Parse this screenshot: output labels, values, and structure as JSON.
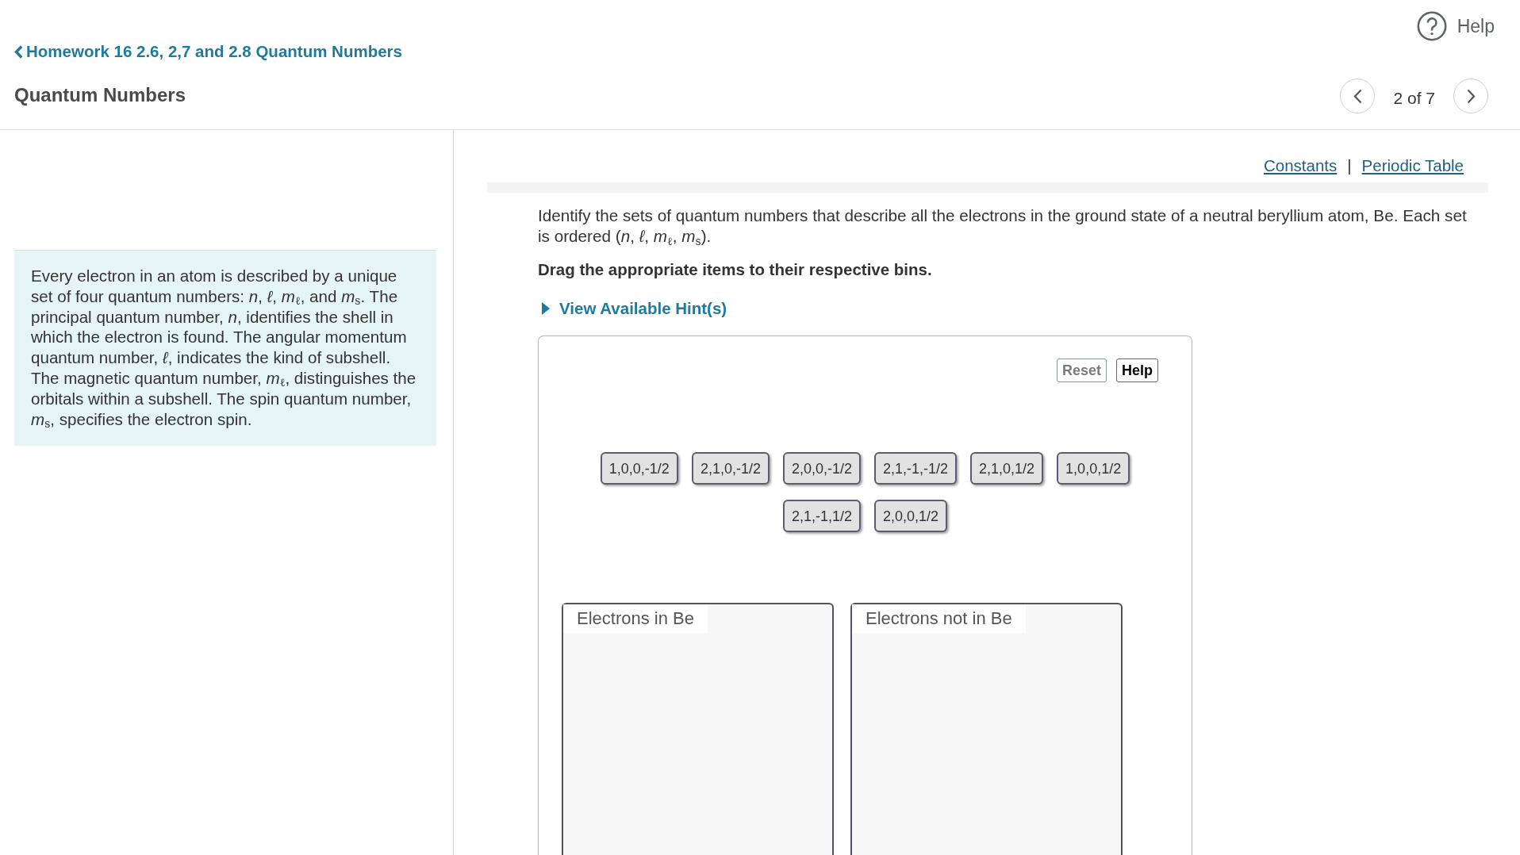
{
  "header": {
    "back_link": "Homework 16 2.6, 2,7 and 2.8 Quantum Numbers",
    "title": "Quantum Numbers",
    "help": "Help",
    "pager": "2 of 7"
  },
  "intro": {
    "text": "Every electron in an atom is described by a unique set of four quantum numbers: *n*, *ℓ*, *m*$_{ℓ}$, and *m*$_{s}$. The principal quantum number, *n*, identifies the shell in which the electron is found. The angular momentum quantum number, *ℓ*, indicates the kind of subshell. The magnetic quantum number, *m*$_{ℓ}$, distinguishes the orbitals within a subshell. The spin quantum number, *m*$_{s}$, specifies the electron spin."
  },
  "resources": {
    "links": [
      "Constants",
      "Periodic Table"
    ],
    "separator": "|"
  },
  "problem": {
    "prompt": "Identify the sets of quantum numbers that describe all the electrons in the ground state of a neutral beryllium atom, Be. Each set is ordered (*n*, *ℓ*, *m*$_{ℓ}$, *m*$_{s}$).",
    "instruction": "Drag the appropriate items to their respective bins.",
    "hints": {
      "label": "View Available Hint(s)",
      "expanded": false
    }
  },
  "drag_area": {
    "buttons": [
      {
        "label": "Reset",
        "disabled": true
      },
      {
        "label": "Help",
        "disabled": false
      }
    ],
    "items": [
      "1,0,0,-1/2",
      "2,1,0,-1/2",
      "2,0,0,-1/2",
      "2,1,-1,-1/2",
      "2,1,0,1/2",
      "1,0,0,1/2",
      "2,1,-1,1/2",
      "2,0,0,1/2"
    ],
    "bins": [
      {
        "label": "Electrons in Be"
      },
      {
        "label": "Electrons not in Be"
      }
    ]
  }
}
